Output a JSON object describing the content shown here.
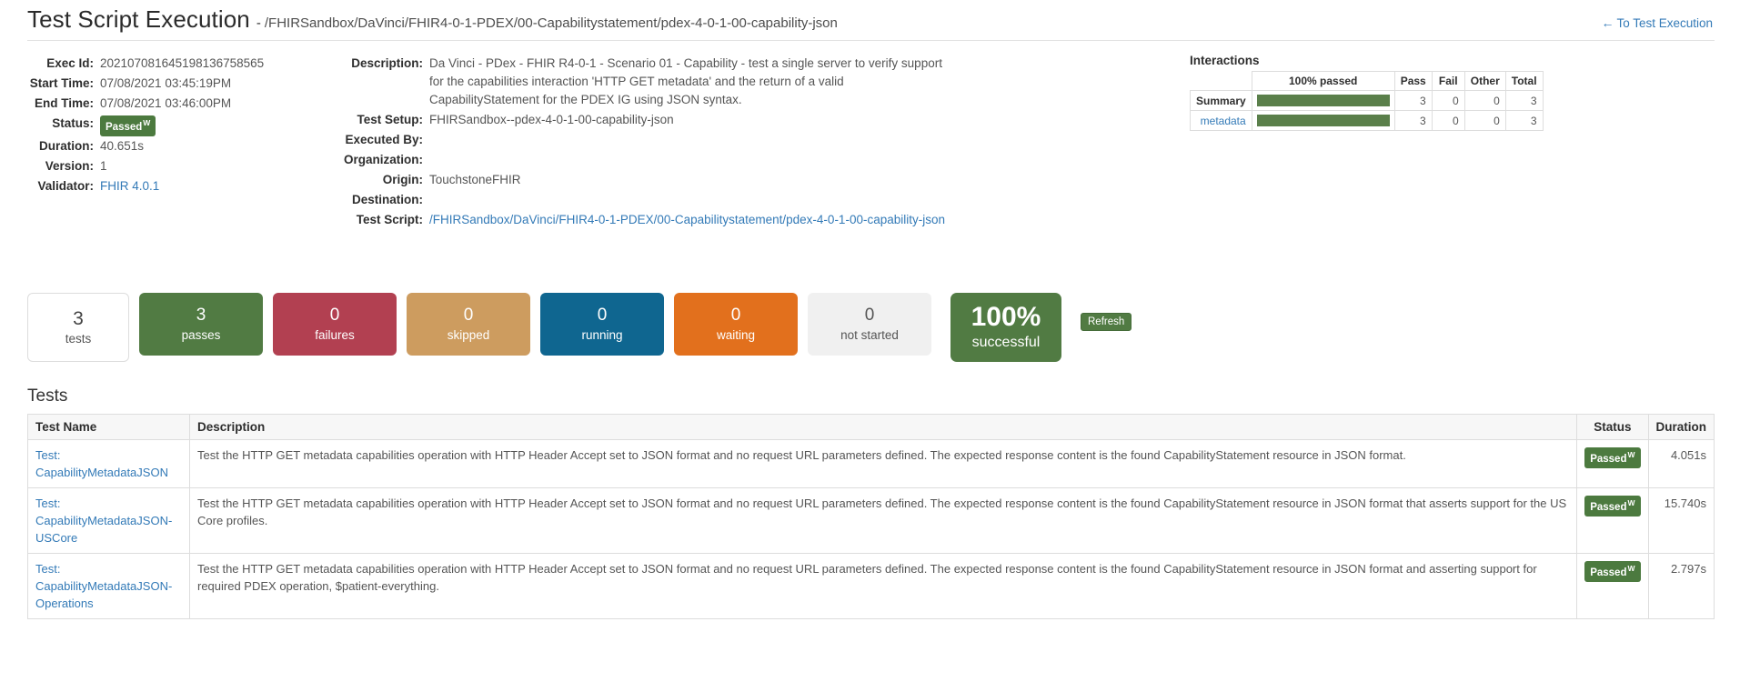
{
  "header": {
    "title": "Test Script Execution",
    "dash": "-",
    "subtitle": "/FHIRSandbox/DaVinci/FHIR4-0-1-PDEX/00-Capabilitystatement/pdex-4-0-1-00-capability-json",
    "back_link": "To Test Execution",
    "back_arrow": "←"
  },
  "exec_info": {
    "exec_id_label": "Exec Id:",
    "exec_id": "202107081645198136758565",
    "start_time_label": "Start Time:",
    "start_time": "07/08/2021 03:45:19PM",
    "end_time_label": "End Time:",
    "end_time": "07/08/2021 03:46:00PM",
    "status_label": "Status:",
    "status": "Passed",
    "status_sup": "W",
    "duration_label": "Duration:",
    "duration": "40.651s",
    "version_label": "Version:",
    "version": "1",
    "validator_label": "Validator:",
    "validator": "FHIR 4.0.1"
  },
  "script_info": {
    "description_label": "Description:",
    "description": "Da Vinci - PDex - FHIR R4-0-1 - Scenario 01 - Capability - test a single server to verify support for the capabilities interaction 'HTTP GET metadata' and the return of a valid CapabilityStatement for the PDEX IG using JSON syntax.",
    "test_setup_label": "Test Setup:",
    "test_setup": "FHIRSandbox--pdex-4-0-1-00-capability-json",
    "executed_by_label": "Executed By:",
    "executed_by": "",
    "organization_label": "Organization:",
    "organization": "",
    "origin_label": "Origin:",
    "origin": "TouchstoneFHIR",
    "destination_label": "Destination:",
    "destination": "",
    "test_script_label": "Test Script:",
    "test_script": "/FHIRSandbox/DaVinci/FHIR4-0-1-PDEX/00-Capabilitystatement/pdex-4-0-1-00-capability-json"
  },
  "interactions": {
    "title": "Interactions",
    "columns": [
      "",
      "100% passed",
      "Pass",
      "Fail",
      "Other",
      "Total"
    ],
    "rows": [
      {
        "label": "Summary",
        "is_link": false,
        "percent": 100,
        "pass": "3",
        "fail": "0",
        "other": "0",
        "total": "3"
      },
      {
        "label": "metadata",
        "is_link": true,
        "percent": 100,
        "pass": "3",
        "fail": "0",
        "other": "0",
        "total": "3"
      }
    ]
  },
  "stats": {
    "boxes": [
      {
        "value": "3",
        "label": "tests",
        "kind": "tests"
      },
      {
        "value": "3",
        "label": "passes",
        "kind": "passes"
      },
      {
        "value": "0",
        "label": "failures",
        "kind": "failures"
      },
      {
        "value": "0",
        "label": "skipped",
        "kind": "skipped"
      },
      {
        "value": "0",
        "label": "running",
        "kind": "running"
      },
      {
        "value": "0",
        "label": "waiting",
        "kind": "waiting"
      },
      {
        "value": "0",
        "label": "not started",
        "kind": "notstarted"
      }
    ],
    "percent_value": "100%",
    "percent_label": "successful",
    "refresh_label": "Refresh"
  },
  "tests": {
    "heading": "Tests",
    "columns": [
      "Test Name",
      "Description",
      "Status",
      "Duration"
    ],
    "rows": [
      {
        "name_prefix": "Test:",
        "name": "CapabilityMetadataJSON",
        "description": "Test the HTTP GET metadata capabilities operation with HTTP Header Accept set to JSON format and no request URL parameters defined. The expected response content is the found CapabilityStatement resource in JSON format.",
        "status": "Passed",
        "status_sup": "W",
        "duration": "4.051s"
      },
      {
        "name_prefix": "Test:",
        "name": "CapabilityMetadataJSON-USCore",
        "description": "Test the HTTP GET metadata capabilities operation with HTTP Header Accept set to JSON format and no request URL parameters defined. The expected response content is the found CapabilityStatement resource in JSON format that asserts support for the US Core profiles.",
        "status": "Passed",
        "status_sup": "W",
        "duration": "15.740s"
      },
      {
        "name_prefix": "Test:",
        "name": "CapabilityMetadataJSON-Operations",
        "description": "Test the HTTP GET metadata capabilities operation with HTTP Header Accept set to JSON format and no request URL parameters defined. The expected response content is the found CapabilityStatement resource in JSON format and asserting support for required PDEX operation, $patient-everything.",
        "status": "Passed",
        "status_sup": "W",
        "duration": "2.797s"
      }
    ]
  },
  "colors": {
    "link": "#337ab7",
    "pass_green": "#517b43",
    "fail_red": "#b24051",
    "skipped_tan": "#cd9c5f",
    "running_blue": "#0f6690",
    "waiting_orange": "#e2701d",
    "notstarted_gray": "#f0f0f0"
  }
}
